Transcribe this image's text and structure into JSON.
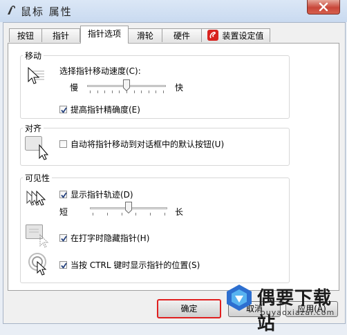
{
  "window": {
    "title": "鼠标 属性"
  },
  "tabs": [
    {
      "label": "按钮"
    },
    {
      "label": "指针"
    },
    {
      "label": "指针选项"
    },
    {
      "label": "滑轮"
    },
    {
      "label": "硬件"
    },
    {
      "label": "装置设定值"
    }
  ],
  "motion": {
    "group_label": "移动",
    "speed_label": "选择指针移动速度(C):",
    "slow_label": "慢",
    "fast_label": "快",
    "speed_value": 0.5,
    "precision_label": "提高指针精确度(E)",
    "precision_checked": true
  },
  "snapto": {
    "group_label": "对齐",
    "snap_label": "自动将指针移动到对话框中的默认按钮(U)",
    "snap_checked": false
  },
  "visibility": {
    "group_label": "可见性",
    "trails_label": "显示指针轨迹(D)",
    "trails_checked": true,
    "short_label": "短",
    "long_label": "长",
    "trails_value": 0.5,
    "hide_label": "在打字时隐藏指针(H)",
    "hide_checked": true,
    "ctrl_label": "当按 CTRL 键时显示指针的位置(S)",
    "ctrl_checked": true
  },
  "buttons": {
    "ok_label": "确定",
    "cancel_label": "取消",
    "apply_label": "应用(A)"
  },
  "watermark": {
    "text": "偶要下载站",
    "url": "ouyaoxiazai.com"
  },
  "colors": {
    "ok_button_highlight": "#e01f1f",
    "titlebar": "#c9daf0",
    "close_button": "#c8473a"
  }
}
